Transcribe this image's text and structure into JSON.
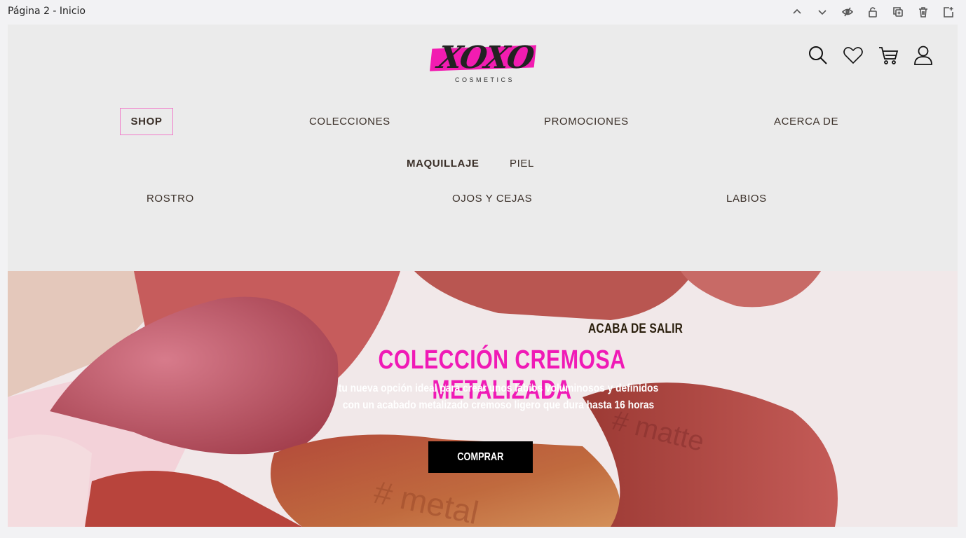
{
  "editor": {
    "page_label": "Página 2 - Inicio",
    "tools": [
      "chevron-up-icon",
      "chevron-down-icon",
      "eye-off-icon",
      "lock-icon",
      "duplicate-icon",
      "trash-icon",
      "add-page-icon"
    ]
  },
  "brand": {
    "logo_text": "XOXO",
    "logo_sub": "COSMETICS",
    "accent": "#f21cb1"
  },
  "header_icons": [
    "search-icon",
    "heart-icon",
    "cart-icon",
    "user-icon"
  ],
  "nav": {
    "main": [
      "SHOP",
      "COLECCIONES",
      "PROMOCIONES",
      "ACERCA DE"
    ],
    "sub": [
      "MAQUILLAJE",
      "PIEL"
    ],
    "categories": [
      "ROSTRO",
      "OJOS Y CEJAS",
      "LABIOS"
    ]
  },
  "hero": {
    "kicker": "ACABA DE SALIR",
    "title": "COLECCIÓN CREMOSA METALIZADA",
    "desc_line1": "tu nueva opción ideal para crear unos labios voluminosos y definidos",
    "desc_line2": "con un acabado metalizado cremoso ligero que dura hasta 16 horas",
    "cta": "COMPRAR",
    "engraving_1": "# metal",
    "engraving_2": "# matte"
  }
}
